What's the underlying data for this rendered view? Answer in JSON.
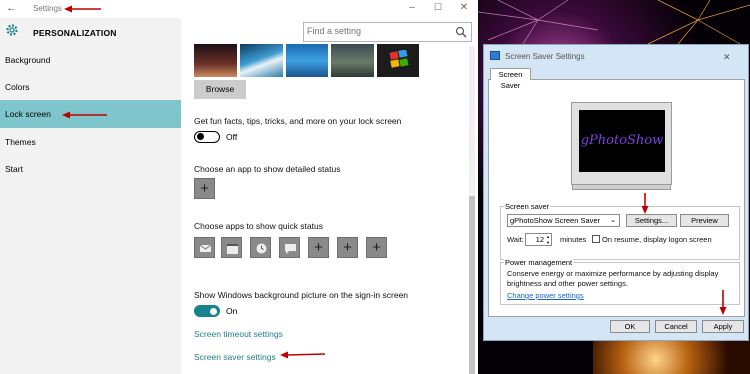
{
  "settings": {
    "window_title": "Settings",
    "section_title": "PERSONALIZATION",
    "search_placeholder": "Find a setting",
    "nav": [
      {
        "label": "Background"
      },
      {
        "label": "Colors"
      },
      {
        "label": "Lock screen"
      },
      {
        "label": "Themes"
      },
      {
        "label": "Start"
      }
    ],
    "active_nav": "Lock screen",
    "browse_label": "Browse",
    "fun_facts_label": "Get fun facts, tips, tricks, and more on your lock screen",
    "fun_facts_toggle": "Off",
    "detailed_status_label": "Choose an app to show detailed status",
    "quick_status_label": "Choose apps to show quick status",
    "signin_bg_label": "Show Windows background picture on the sign-in screen",
    "signin_bg_toggle": "On",
    "screen_timeout_link": "Screen timeout settings",
    "screen_saver_link": "Screen saver settings",
    "accent_color": "#17838c",
    "active_nav_color": "#7fc6cc"
  },
  "dialog": {
    "title": "Screen Saver Settings",
    "tab": "Screen Saver",
    "preview_text": "gPhotoShow",
    "screen_saver_group": "Screen saver",
    "selected_saver": "gPhotoShow Screen Saver",
    "settings_button": "Settings...",
    "preview_button": "Preview",
    "wait_label": "Wait:",
    "wait_value": "12",
    "minutes_label": "minutes",
    "resume_label": "On resume, display logon screen",
    "power_group": "Power management",
    "power_text_1": "Conserve energy or maximize performance by adjusting display",
    "power_text_2": "brightness and other power settings.",
    "power_link": "Change power settings",
    "ok_button": "OK",
    "cancel_button": "Cancel",
    "apply_button": "Apply"
  }
}
